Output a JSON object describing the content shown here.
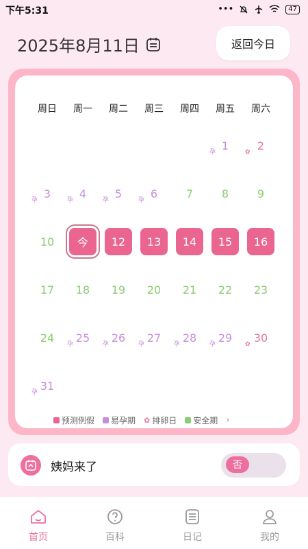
{
  "status": {
    "time": "下午5:31",
    "dots": "•••",
    "battery": "47"
  },
  "header": {
    "date": "2025年8月11日",
    "today_button": "返回今日"
  },
  "calendar": {
    "weekdays": [
      "周日",
      "周一",
      "周二",
      "周三",
      "周四",
      "周五",
      "周六"
    ],
    "days": {
      "1": "1",
      "2": "2",
      "3": "3",
      "4": "4",
      "5": "5",
      "6": "6",
      "7": "7",
      "8": "8",
      "9": "9",
      "10": "10",
      "11": "今",
      "12": "12",
      "13": "13",
      "14": "14",
      "15": "15",
      "16": "16",
      "17": "17",
      "18": "18",
      "19": "19",
      "20": "20",
      "21": "21",
      "22": "22",
      "23": "23",
      "24": "24",
      "25": "25",
      "26": "26",
      "27": "27",
      "28": "28",
      "29": "29",
      "30": "30",
      "31": "31"
    },
    "mark_fertile": "孕",
    "mark_ovulation": "✿",
    "colors": {
      "period": "#ea6590",
      "fertile": "#c78ed8",
      "ovulation": "#e5799e",
      "safe": "#8ccc72"
    }
  },
  "legend": {
    "predicted_period": "预测例假",
    "fertile": "易孕期",
    "ovulation": "排卵日",
    "safe": "安全期",
    "chevron": "›"
  },
  "period_toggle": {
    "label": "姨妈来了",
    "value": "否"
  },
  "nav": {
    "home": "首页",
    "wiki": "百科",
    "diary": "日记",
    "mine": "我的"
  }
}
